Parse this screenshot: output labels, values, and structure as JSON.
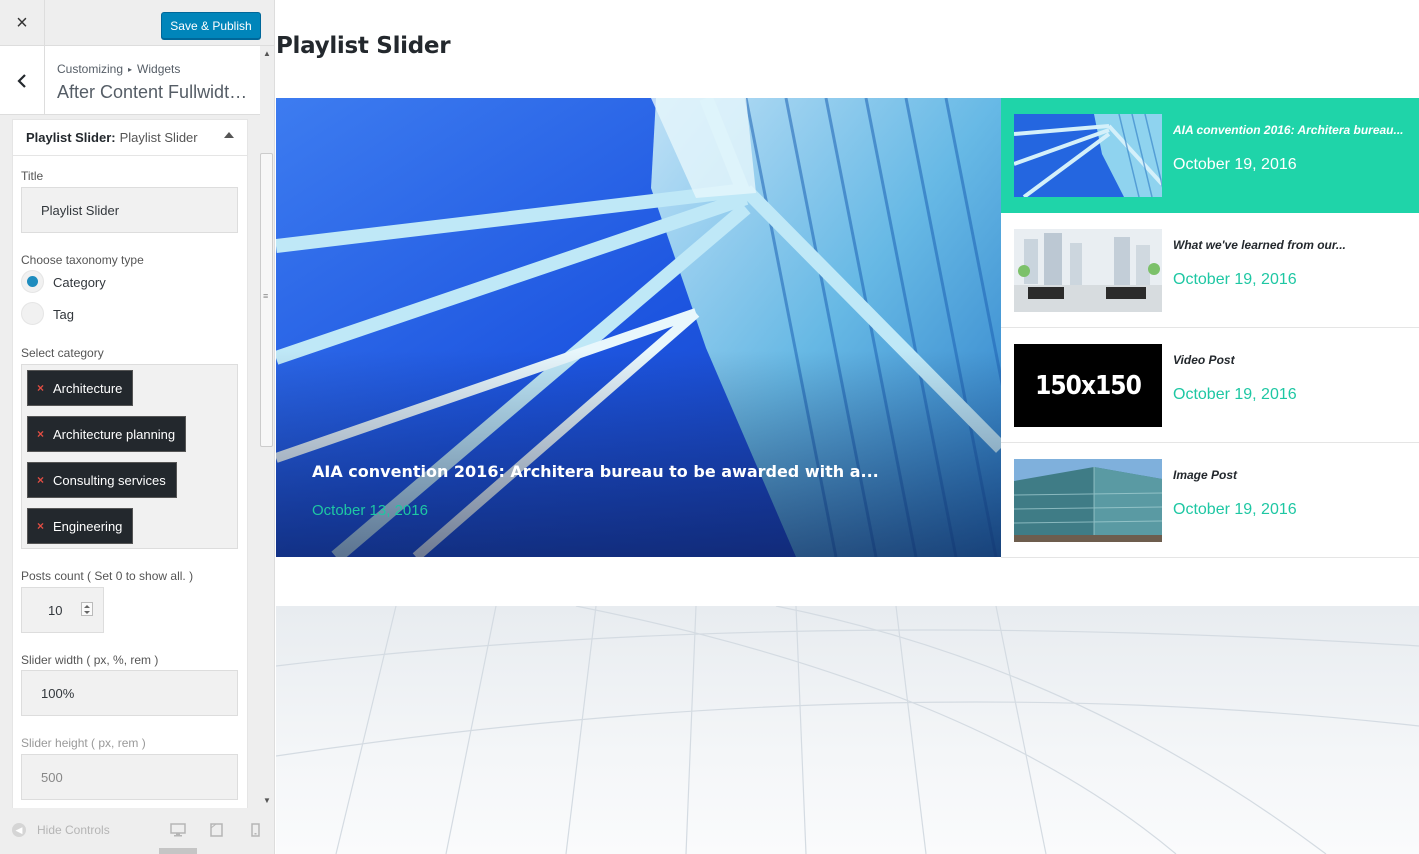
{
  "customizer": {
    "close_label": "×",
    "publish_label": "Save & Publish",
    "breadcrumb": {
      "root": "Customizing",
      "separator": "▸",
      "current": "Widgets"
    },
    "section_title": "After Content Fullwidth...",
    "widget": {
      "name": "Playlist Slider:",
      "instance": "Playlist Slider",
      "fields": {
        "title_label": "Title",
        "title_value": "Playlist Slider",
        "taxonomy_label": "Choose taxonomy type",
        "taxonomy_options": [
          "Category",
          "Tag"
        ],
        "taxonomy_selected": "Category",
        "category_label": "Select category",
        "categories": [
          "Architecture",
          "Architecture planning",
          "Consulting services",
          "Engineering"
        ],
        "chip_remove": "×",
        "posts_count_label": "Posts count ( Set 0 to show all. )",
        "posts_count_value": "10",
        "slider_width_label": "Slider width ( px, %, rem )",
        "slider_width_value": "100%",
        "slider_height_label": "Slider height ( px, rem )",
        "slider_height_value": "500"
      }
    },
    "footer": {
      "hide_controls": "Hide Controls"
    }
  },
  "preview": {
    "heading": "Playlist Slider",
    "hero": {
      "title": "AIA convention 2016: Architera bureau to be awarded with a...",
      "date": "October 13, 2016"
    },
    "playlist": [
      {
        "title": "AIA convention 2016: Architera bureau...",
        "date": "October 19, 2016",
        "thumb": "building-blue",
        "active": true
      },
      {
        "title": "What we've learned from our...",
        "date": "October 19, 2016",
        "thumb": "office-interior",
        "active": false
      },
      {
        "title": "Video Post",
        "date": "October 19, 2016",
        "thumb": "placeholder",
        "placeholder_text": "150x150",
        "active": false
      },
      {
        "title": "Image Post",
        "date": "October 19, 2016",
        "thumb": "glass-building",
        "active": false
      }
    ]
  },
  "colors": {
    "accent": "#1ec7a3",
    "active_bg": "#1fd4a9",
    "publish": "#0085ba"
  }
}
